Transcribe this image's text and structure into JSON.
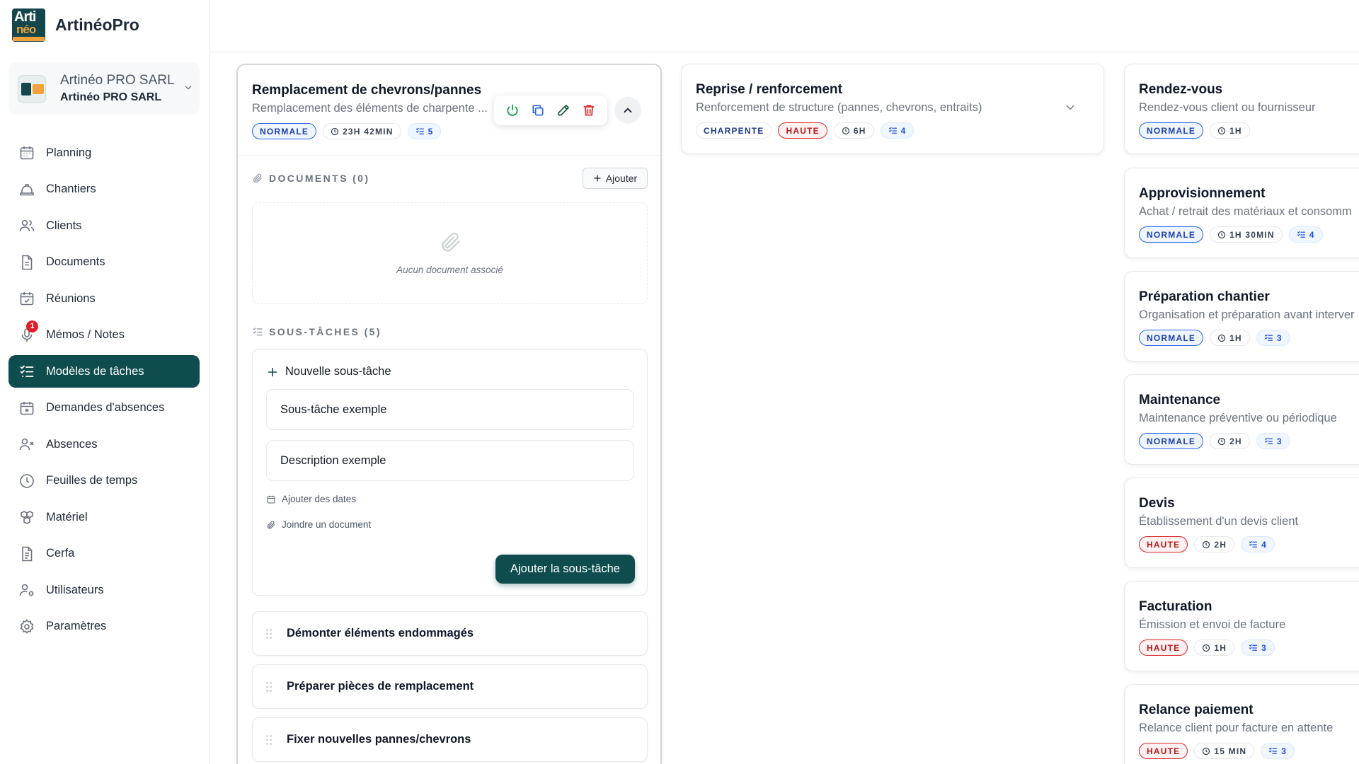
{
  "app": {
    "name": "ArtinéoPro",
    "logo_text_top": "Arti",
    "logo_text_bottom": "néo"
  },
  "company": {
    "name": "Artinéo PRO SARL",
    "subtitle": "Artinéo PRO SARL"
  },
  "sidebar": {
    "items": [
      {
        "label": "Planning",
        "icon": "calendar-icon"
      },
      {
        "label": "Chantiers",
        "icon": "hardhat-icon"
      },
      {
        "label": "Clients",
        "icon": "users-icon"
      },
      {
        "label": "Documents",
        "icon": "document-icon"
      },
      {
        "label": "Réunions",
        "icon": "calendar-check-icon"
      },
      {
        "label": "Mémos / Notes",
        "icon": "microphone-icon",
        "badge": "1"
      },
      {
        "label": "Modèles de tâches",
        "icon": "list-check-icon",
        "active": true
      },
      {
        "label": "Demandes d'absences",
        "icon": "calendar-x-icon"
      },
      {
        "label": "Absences",
        "icon": "user-x-icon"
      },
      {
        "label": "Feuilles de temps",
        "icon": "clock-icon"
      },
      {
        "label": "Matériel",
        "icon": "boxes-icon"
      },
      {
        "label": "Cerfa",
        "icon": "file-text-icon"
      },
      {
        "label": "Utilisateurs",
        "icon": "user-cog-icon"
      },
      {
        "label": "Paramètres",
        "icon": "gear-icon"
      }
    ]
  },
  "expanded_card": {
    "title": "Remplacement de chevrons/pannes",
    "description": "Remplacement des éléments de charpente ...",
    "priority": "NORMALE",
    "duration": "23H 42MIN",
    "subtasks_count": "5",
    "documents_label": "DOCUMENTS (0)",
    "add_label": "Ajouter",
    "empty_documents": "Aucun document associé",
    "subtasks_label": "SOUS-TÂCHES (5)",
    "new_subtask": {
      "header": "Nouvelle sous-tâche",
      "title_value": "Sous-tâche exemple",
      "description_value": "Description exemple",
      "add_dates": "Ajouter des dates",
      "attach_document": "Joindre un document",
      "submit": "Ajouter la sous-tâche"
    },
    "subtasks": [
      "Démonter éléments endommagés",
      "Préparer pièces de remplacement",
      "Fixer nouvelles pannes/chevrons"
    ]
  },
  "middle_card": {
    "title": "Reprise / renforcement",
    "description": "Renforcement de structure (pannes, chevrons, entraits)",
    "category": "CHARPENTE",
    "priority": "HAUTE",
    "duration": "6H",
    "subtasks_count": "4"
  },
  "right_cards": [
    {
      "title": "Rendez-vous",
      "description": "Rendez-vous client ou fournisseur",
      "priority": "NORMALE",
      "priority_color": "blue",
      "duration": "1H",
      "subtasks_count": ""
    },
    {
      "title": "Approvisionnement",
      "description": "Achat / retrait des matériaux et consomm",
      "priority": "NORMALE",
      "priority_color": "blue",
      "duration": "1H 30MIN",
      "subtasks_count": "4"
    },
    {
      "title": "Préparation chantier",
      "description": "Organisation et préparation avant interver",
      "priority": "NORMALE",
      "priority_color": "blue",
      "duration": "1H",
      "subtasks_count": "3"
    },
    {
      "title": "Maintenance",
      "description": "Maintenance préventive ou périodique",
      "priority": "NORMALE",
      "priority_color": "blue",
      "duration": "2H",
      "subtasks_count": "3"
    },
    {
      "title": "Devis",
      "description": "Établissement d'un devis client",
      "priority": "HAUTE",
      "priority_color": "red",
      "duration": "2H",
      "subtasks_count": "4"
    },
    {
      "title": "Facturation",
      "description": "Émission et envoi de facture",
      "priority": "HAUTE",
      "priority_color": "red",
      "duration": "1H",
      "subtasks_count": "3"
    },
    {
      "title": "Relance paiement",
      "description": "Relance client pour facture en attente",
      "priority": "HAUTE",
      "priority_color": "red",
      "duration": "15 MIN",
      "subtasks_count": "3"
    }
  ],
  "colors": {
    "accent": "#0f4c4e",
    "priority_normal": "#2563eb",
    "priority_high": "#dc2626",
    "brand_orange": "#f0a33a"
  }
}
